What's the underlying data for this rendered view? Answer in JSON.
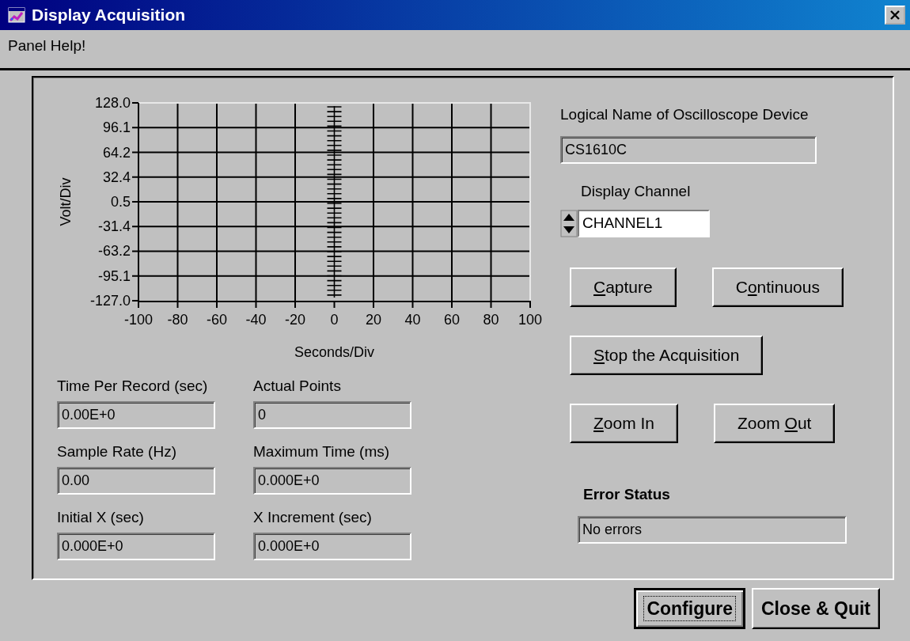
{
  "window": {
    "title": "Display Acquisition"
  },
  "menu": [
    {
      "label": "Panel Help!"
    }
  ],
  "graph": {
    "chart_data": {
      "type": "line",
      "xlabel": "Seconds/Div",
      "ylabel": "Volt/Div",
      "grid": true,
      "xlim": [
        -100,
        100
      ],
      "ylim": [
        -127,
        128
      ],
      "xticks": [
        -100,
        -80,
        -60,
        -40,
        -20,
        0,
        20,
        40,
        60,
        80,
        100
      ],
      "yticks": [
        {
          "value": 128,
          "label": "128.0"
        },
        {
          "value": 96.1,
          "label": "96.1"
        },
        {
          "value": 64.2,
          "label": "64.2"
        },
        {
          "value": 32.4,
          "label": "32.4"
        },
        {
          "value": 0.5,
          "label": "0.5"
        },
        {
          "value": -31.4,
          "label": "-31.4"
        },
        {
          "value": -63.2,
          "label": "-63.2"
        },
        {
          "value": -95.1,
          "label": "-95.1"
        },
        {
          "value": -127,
          "label": "-127.0"
        }
      ]
    }
  },
  "readouts": [
    {
      "label": "Time Per Record (sec)",
      "value": "0.00E+0"
    },
    {
      "label": "Actual Points",
      "value": "0"
    },
    {
      "label": "Sample Rate (Hz)",
      "value": "0.00"
    },
    {
      "label": "Maximum Time (ms)",
      "value": "0.000E+0"
    },
    {
      "label": "Initial X (sec)",
      "value": "0.000E+0"
    },
    {
      "label": "X Increment (sec)",
      "value": "0.000E+0"
    }
  ],
  "device": {
    "label": "Logical Name of Oscilloscope Device",
    "value": "CS1610C"
  },
  "channel": {
    "label": "Display Channel",
    "value": "CHANNEL1"
  },
  "action_rows": [
    {
      "buttons": [
        {
          "mnemonic": "C",
          "label_after": "apture"
        },
        {
          "label_before": "C",
          "mnemonic": "o",
          "label_after": "ntinuous"
        }
      ]
    },
    {
      "buttons": [
        {
          "mnemonic": "S",
          "label_after": "top the Acquisition"
        }
      ]
    },
    {
      "buttons": [
        {
          "mnemonic": "Z",
          "label_after": "oom In"
        },
        {
          "label_before": "Zoom ",
          "mnemonic": "O",
          "label_after": "ut"
        }
      ]
    }
  ],
  "error_status": {
    "label": "Error Status",
    "value": "No errors"
  },
  "footer_buttons": [
    {
      "label": "Configure",
      "focused": true
    },
    {
      "label": "Close & Quit",
      "focused": false
    }
  ]
}
